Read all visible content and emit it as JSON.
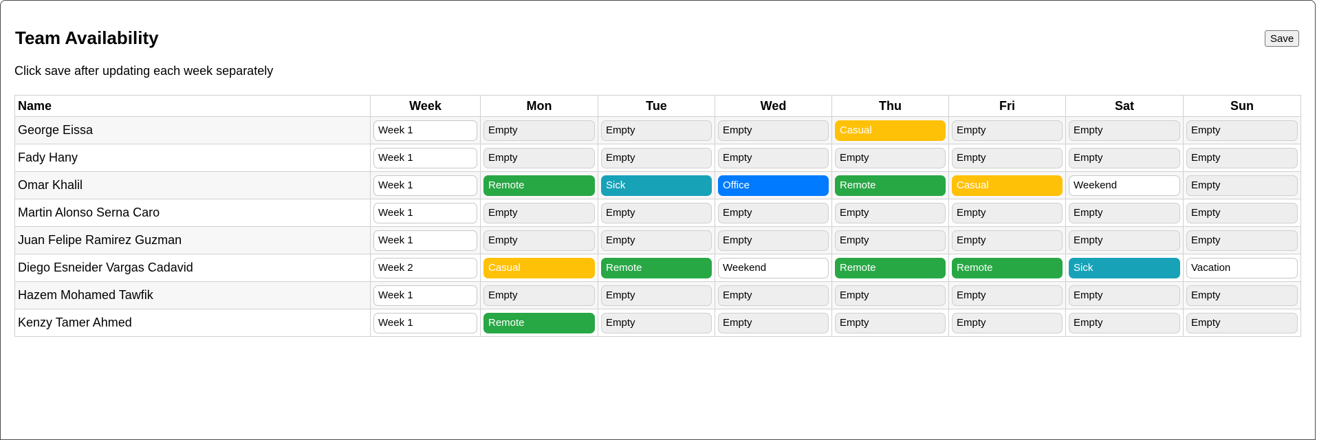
{
  "title": "Team Availability",
  "save_label": "Save",
  "hint": "Click save after updating each week separately",
  "columns": [
    "Name",
    "Week",
    "Mon",
    "Tue",
    "Wed",
    "Thu",
    "Fri",
    "Sat",
    "Sun"
  ],
  "status_colors": {
    "Empty": "#eeeeee",
    "Casual": "#ffc107",
    "Remote": "#28a745",
    "Sick": "#17a2b8",
    "Office": "#007bff",
    "Weekend": "#ffffff",
    "Vacation": "#ffffff"
  },
  "rows": [
    {
      "name": "George Eissa",
      "week": "Week 1",
      "days": [
        "Empty",
        "Empty",
        "Empty",
        "Casual",
        "Empty",
        "Empty",
        "Empty"
      ]
    },
    {
      "name": "Fady Hany",
      "week": "Week 1",
      "days": [
        "Empty",
        "Empty",
        "Empty",
        "Empty",
        "Empty",
        "Empty",
        "Empty"
      ]
    },
    {
      "name": "Omar Khalil",
      "week": "Week 1",
      "days": [
        "Remote",
        "Sick",
        "Office",
        "Remote",
        "Casual",
        "Weekend",
        "Empty"
      ]
    },
    {
      "name": "Martin Alonso Serna Caro",
      "week": "Week 1",
      "days": [
        "Empty",
        "Empty",
        "Empty",
        "Empty",
        "Empty",
        "Empty",
        "Empty"
      ]
    },
    {
      "name": "Juan Felipe Ramirez Guzman",
      "week": "Week 1",
      "days": [
        "Empty",
        "Empty",
        "Empty",
        "Empty",
        "Empty",
        "Empty",
        "Empty"
      ]
    },
    {
      "name": "Diego Esneider Vargas Cadavid",
      "week": "Week 2",
      "days": [
        "Casual",
        "Remote",
        "Weekend",
        "Remote",
        "Remote",
        "Sick",
        "Vacation"
      ]
    },
    {
      "name": "Hazem Mohamed Tawfik",
      "week": "Week 1",
      "days": [
        "Empty",
        "Empty",
        "Empty",
        "Empty",
        "Empty",
        "Empty",
        "Empty"
      ]
    },
    {
      "name": "Kenzy Tamer Ahmed",
      "week": "Week 1",
      "days": [
        "Remote",
        "Empty",
        "Empty",
        "Empty",
        "Empty",
        "Empty",
        "Empty"
      ]
    }
  ]
}
